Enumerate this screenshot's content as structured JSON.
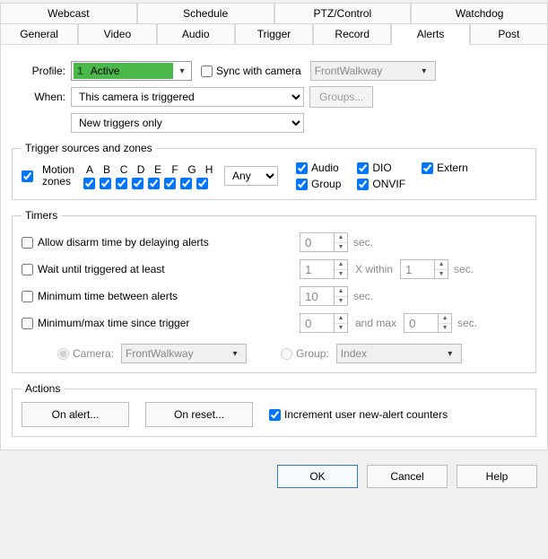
{
  "tabs_top": [
    "Webcast",
    "Schedule",
    "PTZ/Control",
    "Watchdog"
  ],
  "tabs_bottom": [
    "General",
    "Video",
    "Audio",
    "Trigger",
    "Record",
    "Alerts",
    "Post"
  ],
  "active_tab": "Alerts",
  "profile": {
    "label": "Profile:",
    "num": "1",
    "name": "Active",
    "sync_label": "Sync with camera",
    "sync_checked": false,
    "camera_name": "FrontWalkway"
  },
  "when": {
    "label": "When:",
    "value": "This camera is triggered",
    "groups_btn": "Groups...",
    "new_triggers": "New triggers only"
  },
  "trigger_sources": {
    "legend": "Trigger sources and zones",
    "motion_label_top": "Motion",
    "motion_label_bot": "zones",
    "motion_checked": true,
    "zone_letters": [
      "A",
      "B",
      "C",
      "D",
      "E",
      "F",
      "G",
      "H"
    ],
    "zone_checked": [
      true,
      true,
      true,
      true,
      true,
      true,
      true,
      true
    ],
    "match_select": "Any",
    "srcs": {
      "audio": {
        "label": "Audio",
        "checked": true
      },
      "dio": {
        "label": "DIO",
        "checked": true
      },
      "extern": {
        "label": "Extern",
        "checked": true
      },
      "group": {
        "label": "Group",
        "checked": true
      },
      "onvif": {
        "label": "ONVIF",
        "checked": true
      }
    }
  },
  "timers": {
    "legend": "Timers",
    "rows": {
      "disarm": {
        "label": "Allow disarm time by delaying alerts",
        "checked": false,
        "val": "0",
        "suffix": "sec."
      },
      "wait": {
        "label": "Wait until triggered at least",
        "checked": false,
        "val": "1",
        "mid": "X within",
        "val2": "1",
        "suffix": "sec."
      },
      "minbtw": {
        "label": "Minimum time between alerts",
        "checked": false,
        "val": "10",
        "suffix": "sec."
      },
      "minmax": {
        "label": "Minimum/max time since trigger",
        "checked": false,
        "val": "0",
        "mid": "and max",
        "val2": "0",
        "suffix": "sec."
      }
    },
    "camera_radio": "Camera:",
    "camera_value": "FrontWalkway",
    "group_radio": "Group:",
    "group_value": "Index"
  },
  "actions": {
    "legend": "Actions",
    "on_alert": "On alert...",
    "on_reset": "On reset...",
    "increment_label": "Increment user new-alert counters",
    "increment_checked": true
  },
  "footer": {
    "ok": "OK",
    "cancel": "Cancel",
    "help": "Help"
  }
}
